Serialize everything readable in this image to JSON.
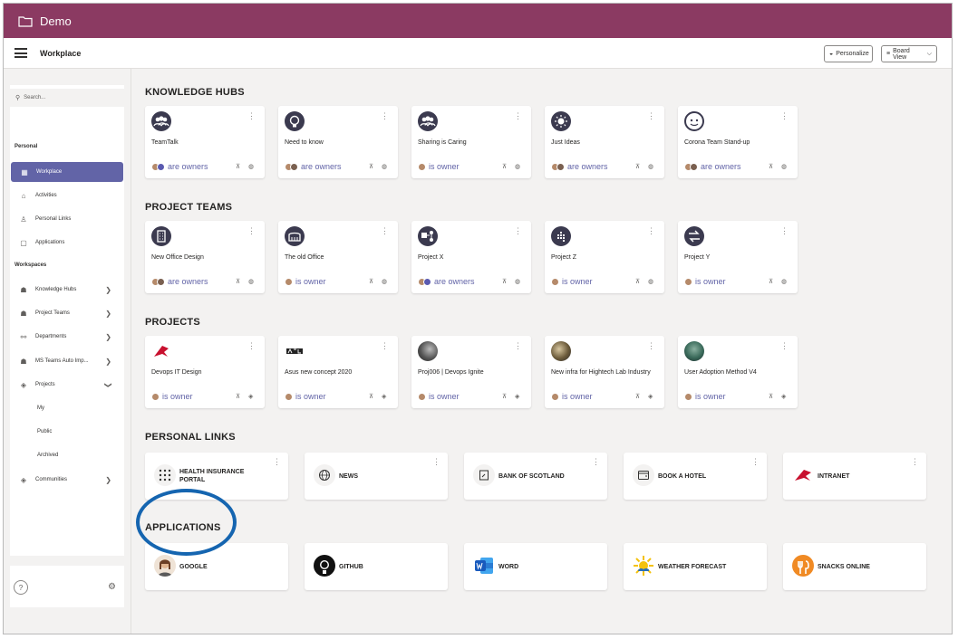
{
  "window": {
    "title": "Demo"
  },
  "topbar": {
    "title": "Workplace",
    "personalize": "Personalize",
    "boardview": "Board View"
  },
  "sidebar": {
    "search_placeholder": "Search...",
    "personal_label": "Personal",
    "personal": [
      {
        "label": "Workplace",
        "icon": "grid-icon"
      },
      {
        "label": "Activities",
        "icon": "home-icon"
      },
      {
        "label": "Personal Links",
        "icon": "person-icon"
      },
      {
        "label": "Applications",
        "icon": "app-icon"
      }
    ],
    "workspaces_label": "Workspaces",
    "workspaces": [
      {
        "label": "Knowledge Hubs",
        "icon": "teams-icon"
      },
      {
        "label": "Project Teams",
        "icon": "teams-icon"
      },
      {
        "label": "Departments",
        "icon": "org-icon"
      },
      {
        "label": "MS Teams Auto Imp...",
        "icon": "teams-icon"
      },
      {
        "label": "Projects",
        "icon": "project-icon"
      },
      {
        "label": "Communities",
        "icon": "project-icon"
      }
    ],
    "project_subs": [
      "My",
      "Public",
      "Archived"
    ]
  },
  "sections": {
    "knowledge_hubs": "KNOWLEDGE HUBS",
    "project_teams": "PROJECT TEAMS",
    "projects": "PROJECTS",
    "personal_links": "PERSONAL LINKS",
    "applications": "APPLICATIONS"
  },
  "knowledge_hubs": [
    {
      "name": "TeamTalk",
      "owners": "are owners"
    },
    {
      "name": "Need to know",
      "owners": "are owners"
    },
    {
      "name": "Sharing is Caring",
      "owners": "is owner"
    },
    {
      "name": "Just Ideas",
      "owners": "are owners"
    },
    {
      "name": "Corona Team Stand-up",
      "owners": "are owners"
    }
  ],
  "project_teams": [
    {
      "name": "New Office Design",
      "owners": "are owners"
    },
    {
      "name": "The old Office",
      "owners": "is owner"
    },
    {
      "name": "Project X",
      "owners": "are owners"
    },
    {
      "name": "Project Z",
      "owners": "is owner"
    },
    {
      "name": "Project Y",
      "owners": "is owner"
    }
  ],
  "projects": [
    {
      "name": "Devops IT Design",
      "owners": "is owner"
    },
    {
      "name": "Asus new concept 2020",
      "owners": "is owner"
    },
    {
      "name": "Proj006 | Devops Ignite",
      "owners": "is owner"
    },
    {
      "name": "New infra for Hightech Lab Industry",
      "owners": "is owner"
    },
    {
      "name": "User Adoption Method V4",
      "owners": "is owner"
    }
  ],
  "personal_links": [
    {
      "name": "HEALTH INSURANCE PORTAL"
    },
    {
      "name": "NEWS"
    },
    {
      "name": "BANK OF SCOTLAND"
    },
    {
      "name": "BOOK A HOTEL"
    },
    {
      "name": "INTRANET"
    }
  ],
  "applications": [
    {
      "name": "GOOGLE"
    },
    {
      "name": "GITHUB"
    },
    {
      "name": "WORD"
    },
    {
      "name": "WEATHER FORECAST"
    },
    {
      "name": "SNACKS ONLINE"
    }
  ],
  "colors": {
    "titlebar": "#8b3a62",
    "accent": "#6264a7",
    "highlight_circle": "#1565b0"
  }
}
